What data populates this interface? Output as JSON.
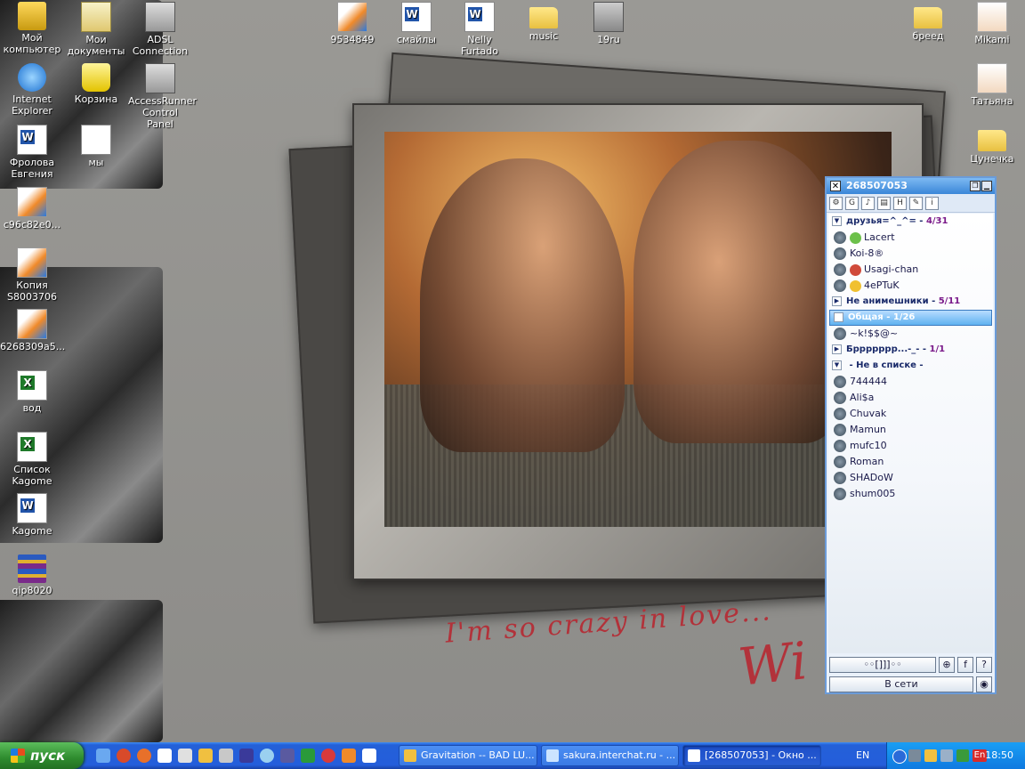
{
  "desktop": {
    "icons": [
      {
        "label": "Мой компьютер",
        "icon": "my-computer-icon"
      },
      {
        "label": "Мои документы",
        "icon": "my-documents-icon"
      },
      {
        "label": "ADSL Connection",
        "icon": "network-connection-icon"
      },
      {
        "label": "Internet Explorer",
        "icon": "internet-explorer-icon"
      },
      {
        "label": "Корзина",
        "icon": "recycle-bin-icon"
      },
      {
        "label": "AccessRunner Control Panel",
        "icon": "control-panel-icon"
      },
      {
        "label": "Фролова Евгения",
        "icon": "word-document-icon"
      },
      {
        "label": "мы",
        "icon": "wmv-video-icon"
      },
      {
        "label": "c96c82e0...",
        "icon": "image-file-icon"
      },
      {
        "label": "Копия S8003706",
        "icon": "image-file-icon"
      },
      {
        "label": "6268309a5...",
        "icon": "image-file-icon"
      },
      {
        "label": "вод",
        "icon": "excel-document-icon"
      },
      {
        "label": "Список Kagome",
        "icon": "excel-document-icon"
      },
      {
        "label": "Kagome",
        "icon": "word-document-icon"
      },
      {
        "label": "qip8020",
        "icon": "winrar-archive-icon"
      },
      {
        "label": "9534849",
        "icon": "image-file-icon"
      },
      {
        "label": "смайлы",
        "icon": "word-document-icon"
      },
      {
        "label": "Nelly Furtado",
        "icon": "word-document-icon"
      },
      {
        "label": "music",
        "icon": "folder-icon"
      },
      {
        "label": "19ru",
        "icon": "png-file-icon"
      },
      {
        "label": "бреед",
        "icon": "folder-icon"
      },
      {
        "label": "Mikami",
        "icon": "avatar-image-icon"
      },
      {
        "label": "Татьяна",
        "icon": "avatar-image-icon"
      },
      {
        "label": "Цунечка",
        "icon": "folder-icon"
      }
    ],
    "wallpaper_text": "I'm so crazy in love...",
    "wallpaper_signature": "Wi"
  },
  "qip": {
    "title": "268507053",
    "groups": [
      {
        "name": "друзья=^_^= - ",
        "count": "4/31",
        "expanded": true,
        "contacts": [
          "Lacert",
          "Koi-8®",
          "Usagi-chan",
          "4ePTuK"
        ]
      },
      {
        "name": "Не анимешники - ",
        "count": "5/11",
        "expanded": false,
        "contacts": []
      },
      {
        "name": "Общая - ",
        "count": "1/26",
        "expanded": true,
        "selected": true,
        "contacts": [
          "~k!$$@~"
        ]
      },
      {
        "name": "Бррррррр...-_- - ",
        "count": "1/1",
        "expanded": false,
        "contacts": []
      },
      {
        "name": " - Не в списке - ",
        "count": "",
        "expanded": true,
        "contacts": [
          "744444",
          "Ali$a",
          "Chuvak",
          "Mamun",
          "mufc10",
          "Roman",
          "SHADoW",
          "shum005"
        ]
      }
    ],
    "bottom_status": "В сети",
    "bottom_center_label": "◦◦[]]]◦◦"
  },
  "taskbar": {
    "start_label": "пуск",
    "tasks": [
      {
        "label": "Gravitation -- BAD LU..."
      },
      {
        "label": "sakura.interchat.ru - ..."
      },
      {
        "label": "[268507053] - Окно ..."
      }
    ],
    "lang_indicator": "EN",
    "tray_lang": "En",
    "clock": "18:50"
  },
  "colors": {
    "taskbar_blue": "#245edb",
    "start_green": "#2e8b2e",
    "wallpaper_text_red": "#b2323a",
    "qip_accent": "#3a86d8"
  }
}
